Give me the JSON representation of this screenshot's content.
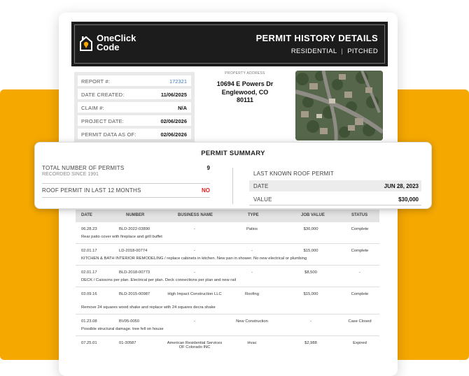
{
  "brand": {
    "name_line1": "OneClick",
    "name_line2": "Code"
  },
  "header": {
    "title": "PERMIT HISTORY DETAILS",
    "type": "RESIDENTIAL",
    "separator": "|",
    "roof": "PITCHED"
  },
  "report_info": [
    {
      "label": "REPORT #:",
      "value": "172321"
    },
    {
      "label": "DATE CREATED:",
      "value": "11/06/2025"
    },
    {
      "label": "CLAIM #:",
      "value": "N/A"
    },
    {
      "label": "PROJECT DATE:",
      "value": "02/06/2026"
    },
    {
      "label": "PERMIT DATA AS OF:",
      "value": "02/06/2026"
    }
  ],
  "property": {
    "label": "PROPERTY ADDRESS",
    "street": "10694 E Powers Dr",
    "city": "Englewood, CO",
    "zip": "80111"
  },
  "summary": {
    "title": "PERMIT SUMMARY",
    "total_label": "TOTAL NUMBER OF PERMITS",
    "total_sub": "RECORDED SINCE 1991",
    "total_value": "9",
    "roof12_label": "ROOF PERMIT IN LAST 12 MONTHS",
    "roof12_value": "NO",
    "last_roof_label": "LAST KNOWN ROOF PERMIT",
    "date_label": "DATE",
    "date_value": "JUN 28, 2023",
    "value_label": "VALUE",
    "value_value": "$30,000"
  },
  "table": {
    "headers": {
      "date": "DATE",
      "number": "NUMBER",
      "business": "BUSINESS NAME",
      "type": "TYPE",
      "job_value": "JOB VALUE",
      "status": "STATUS"
    },
    "rows": [
      {
        "date": "06.28.23",
        "number": "BLD-2022-03890",
        "business": "-",
        "type": "Patios",
        "job_value": "$30,000",
        "status": "Complete",
        "desc": "Rear patio cover with fireplace and grill buffet"
      },
      {
        "date": "02.01.17",
        "number": "LD-2018-00774",
        "business": "-",
        "type": "-",
        "job_value": "$15,000",
        "status": "Complete",
        "desc": "KITCHEN & BATH INTERIOR REMODELING / replace cabinets in kitchen. New pan in shower. No new electrical or plumbing"
      },
      {
        "date": "02.01.17",
        "number": "BLD-2018-00773",
        "business": "-",
        "type": "-",
        "job_value": "$8,500",
        "status": "-",
        "desc": "DECK / Caissons per plan. Electrical per plan. Deck connections per plan and new rail"
      },
      {
        "date": "03.09.16",
        "number": "BLD-2015-00987",
        "business": "High Impact Construction LLC",
        "type": "Roofing",
        "job_value": "$15,000",
        "status": "Complete",
        "desc": "Remove 24 squares wood shake and replace with 24 squares decra shake"
      },
      {
        "date": "01.23.08",
        "number": "BV05-0050",
        "business": "-",
        "type": "New Construction",
        "job_value": "-",
        "status": "Case Closed",
        "desc": "Possible structural damage. tree fell on house"
      },
      {
        "date": "07.25.01",
        "number": "01-30587",
        "business": "American Residential Services OF Colorado INC",
        "type": "Hvac",
        "job_value": "$2,988",
        "status": "Expired",
        "desc": ""
      }
    ]
  },
  "colors": {
    "accent": "#F5A800",
    "header_bg": "#1c1c1c",
    "link": "#3b7bbd",
    "alert": "#e01d1d"
  }
}
